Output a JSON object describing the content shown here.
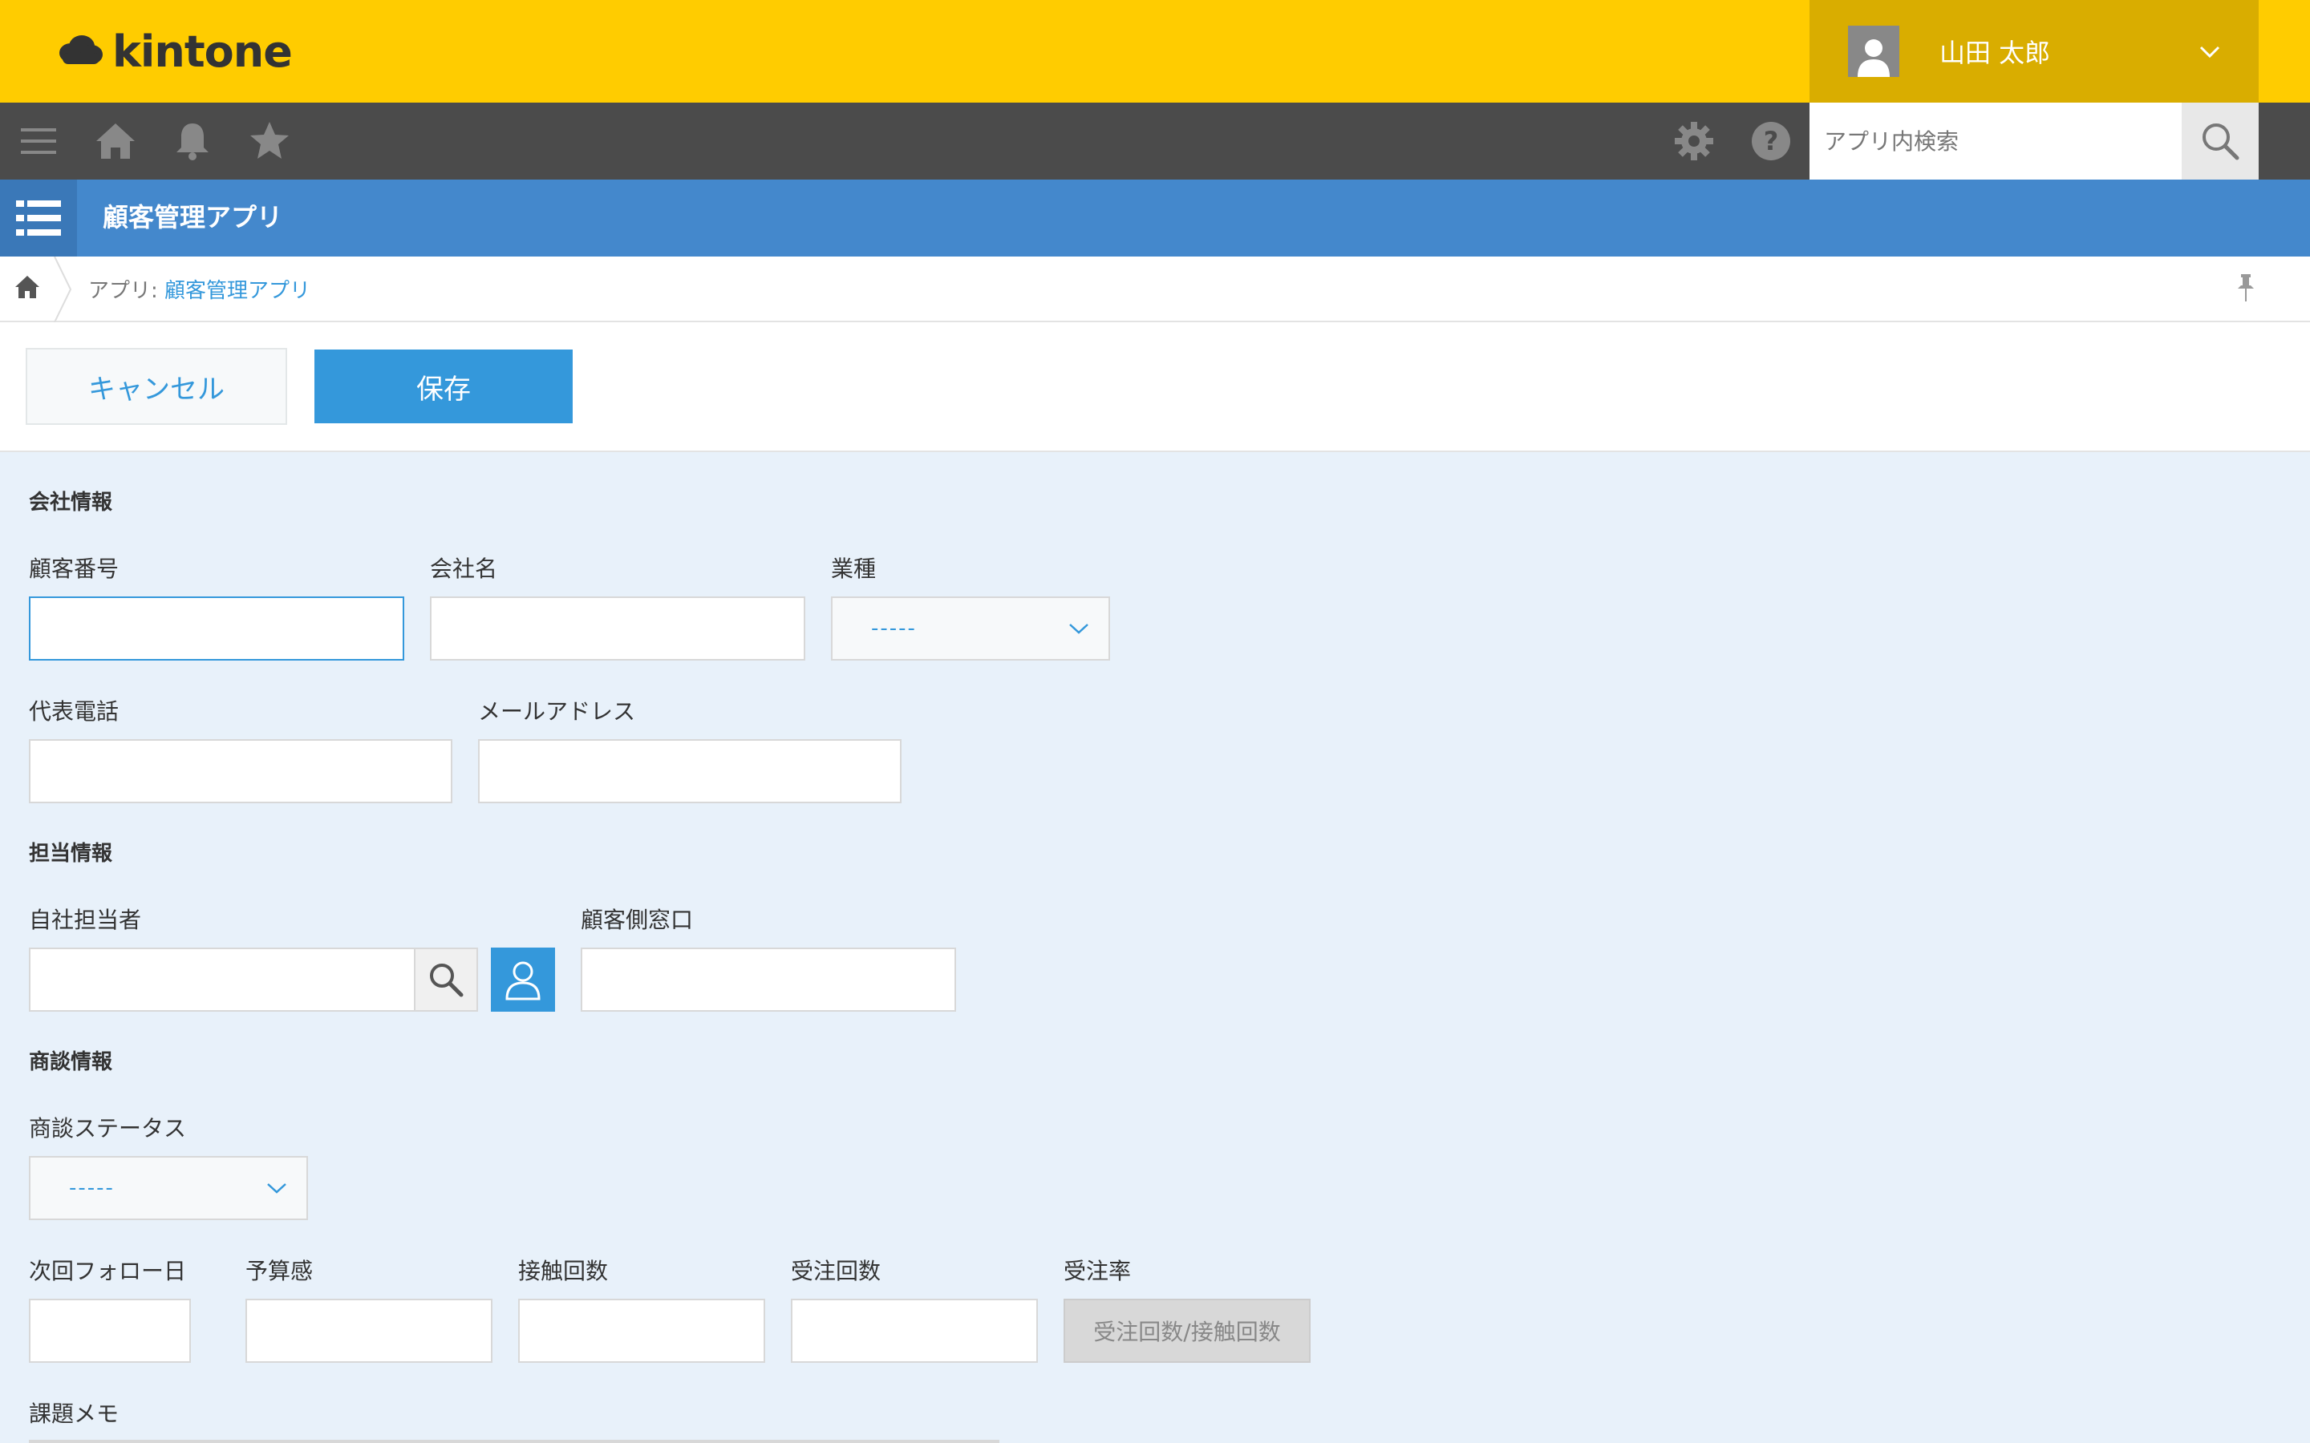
{
  "header": {
    "logo_text": "kintone",
    "user_name": "山田 太郎"
  },
  "toolbar": {
    "search_placeholder": "アプリ内検索"
  },
  "app": {
    "title": "顧客管理アプリ"
  },
  "breadcrumb": {
    "prefix": "アプリ: ",
    "app_link": "顧客管理アプリ"
  },
  "actions": {
    "cancel_label": "キャンセル",
    "save_label": "保存"
  },
  "sections": {
    "company": "会社情報",
    "staff": "担当情報",
    "deal": "商談情報"
  },
  "fields": {
    "customer_no": {
      "label": "顧客番号",
      "value": ""
    },
    "company_name": {
      "label": "会社名",
      "value": ""
    },
    "industry": {
      "label": "業種",
      "selected": "-----"
    },
    "phone": {
      "label": "代表電話",
      "value": ""
    },
    "email": {
      "label": "メールアドレス",
      "value": ""
    },
    "own_staff": {
      "label": "自社担当者",
      "value": ""
    },
    "customer_contact": {
      "label": "顧客側窓口",
      "value": ""
    },
    "deal_status": {
      "label": "商談ステータス",
      "selected": "-----"
    },
    "next_follow": {
      "label": "次回フォロー日",
      "value": ""
    },
    "budget": {
      "label": "予算感",
      "value": ""
    },
    "contact_count": {
      "label": "接触回数",
      "value": ""
    },
    "order_count": {
      "label": "受注回数",
      "value": ""
    },
    "order_rate": {
      "label": "受注率",
      "formula": "受注回数/接触回数"
    },
    "memo": {
      "label": "課題メモ"
    }
  },
  "colors": {
    "header_yellow": "#ffcc00",
    "user_area": "#d9ad00",
    "toolbar_dark": "#4b4b4b",
    "app_bar_blue": "#4488cc",
    "accent_blue": "#3498db",
    "form_background": "#e8f1fa"
  }
}
